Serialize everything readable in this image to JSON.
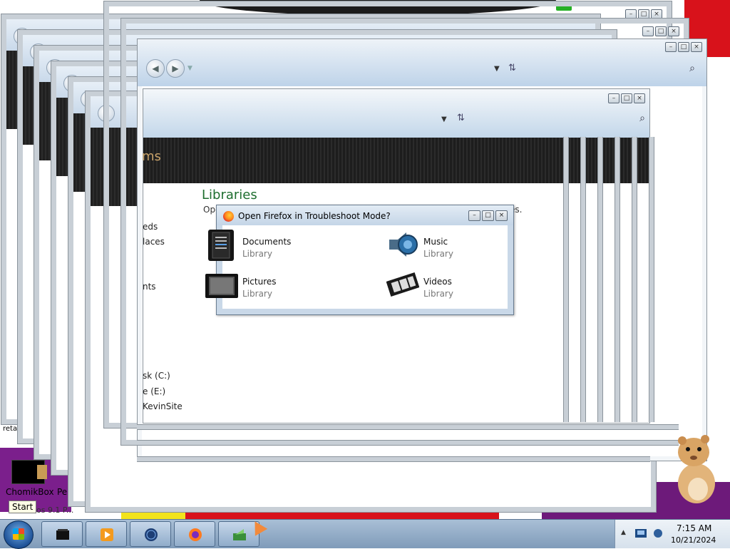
{
  "dialog": {
    "title": "Open Firefox in Troubleshoot Mode?",
    "controls": [
      "minimize-icon",
      "maximize-icon",
      "close-icon"
    ],
    "items": [
      {
        "name": "Documents",
        "kind": "Library",
        "icon": "documents-library-icon"
      },
      {
        "name": "Music",
        "kind": "Library",
        "icon": "music-library-icon"
      },
      {
        "name": "Pictures",
        "kind": "Library",
        "icon": "pictures-library-icon"
      },
      {
        "name": "Videos",
        "kind": "Library",
        "icon": "videos-library-icon"
      }
    ]
  },
  "explorer": {
    "heading": "Libraries",
    "sub_start": "Ope",
    "sub_end": "es.",
    "header_fragment": "ms",
    "side": [
      "eds",
      "laces",
      "nts",
      "sk (C:)",
      "e (E:)",
      "KevinSite"
    ]
  },
  "desktop": {
    "chomikbox_label": "ChomikBox",
    "peek_label": "Pe",
    "red_label": "reta",
    "start_tooltip": "Start",
    "behind_text": "dos 9.1 P..."
  },
  "taskbar": {
    "buttons": [
      {
        "name": "terminal",
        "icon": "black-box-icon"
      },
      {
        "name": "media-player",
        "icon": "play-icon"
      },
      {
        "name": "globe",
        "icon": "globe-icon"
      },
      {
        "name": "firefox",
        "icon": "firefox-icon"
      },
      {
        "name": "installer",
        "icon": "green-arrow-icon"
      }
    ],
    "clock_time": "7:15 AM",
    "clock_date": "10/21/2024"
  },
  "colors": {
    "accent_green": "#1e6e2f",
    "taskbar": "#90acca",
    "wallpaper_red": "#d8121b",
    "wallpaper_purple": "#7b1f8c"
  }
}
